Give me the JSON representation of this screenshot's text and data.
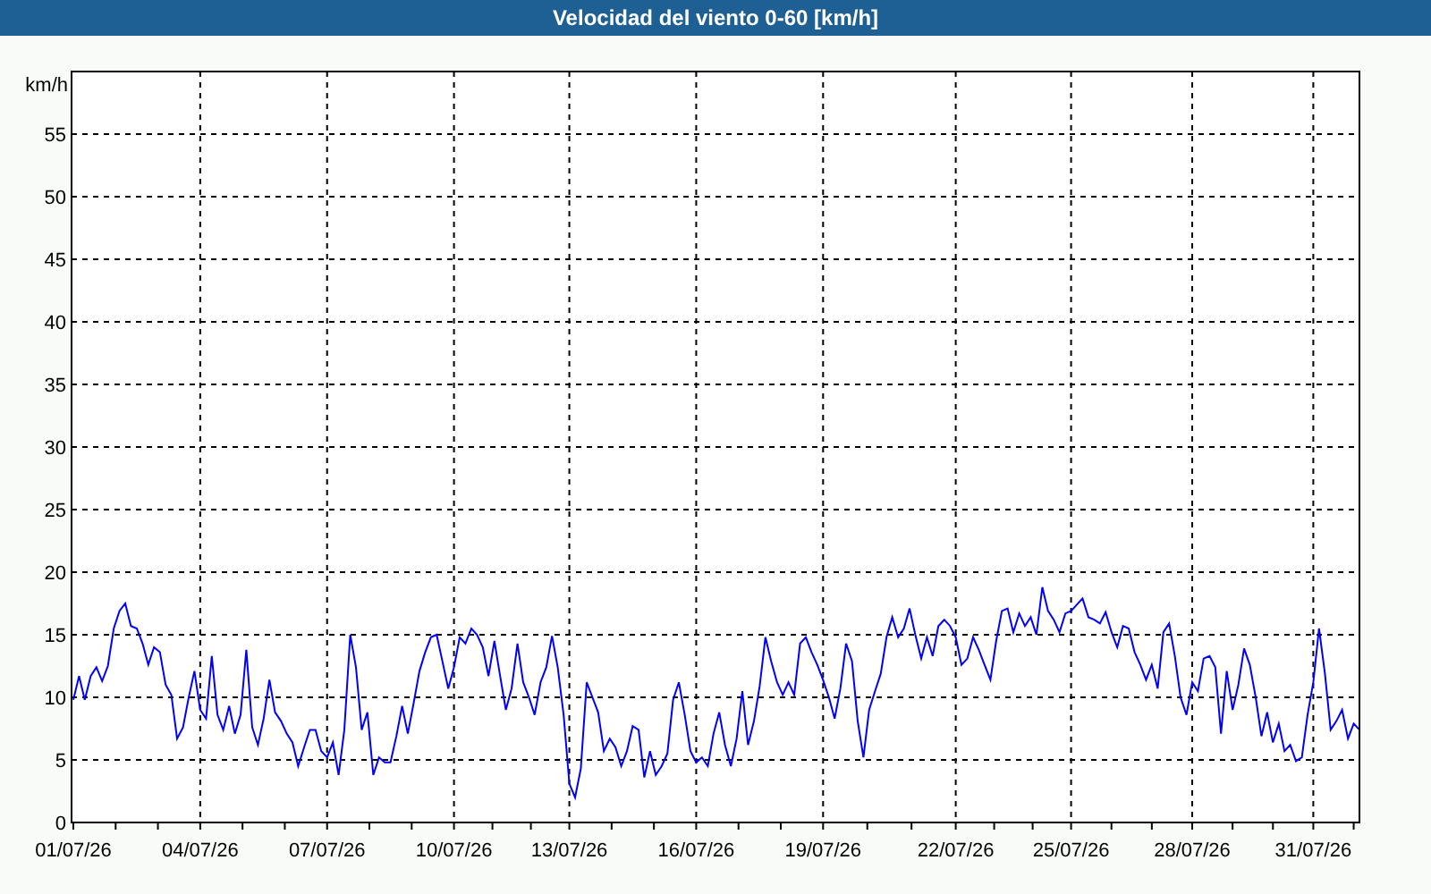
{
  "chart_data": {
    "type": "line",
    "grid": true,
    "title": "Velocidad del viento 0-60 [km/h]",
    "ylabel": "km/h",
    "ylim": [
      0,
      60
    ],
    "yticks": [
      0,
      5,
      10,
      15,
      20,
      25,
      30,
      35,
      40,
      45,
      50,
      55
    ],
    "categories": [
      "01/07/26",
      null,
      null,
      null,
      null,
      null,
      null,
      null,
      null,
      null,
      null,
      null,
      null,
      null,
      null,
      null,
      null,
      null,
      null,
      null,
      null,
      null,
      "04/07/26",
      null,
      null,
      null,
      null,
      null,
      null,
      null,
      null,
      null,
      null,
      null,
      null,
      null,
      null,
      null,
      null,
      null,
      null,
      null,
      null,
      null,
      "07/07/26",
      null,
      null,
      null,
      null,
      null,
      null,
      null,
      null,
      null,
      null,
      null,
      null,
      null,
      null,
      null,
      null,
      null,
      null,
      null,
      null,
      null,
      "10/07/26",
      null,
      null,
      null,
      null,
      null,
      null,
      null,
      null,
      null,
      null,
      null,
      null,
      null,
      null,
      null,
      null,
      null,
      null,
      null,
      "13/07/26",
      null,
      null,
      null,
      null,
      null,
      null,
      null,
      null,
      null,
      null,
      null,
      null,
      null,
      null,
      null,
      null,
      null,
      null,
      null,
      null,
      null,
      "16/07/26",
      null,
      null,
      null,
      null,
      null,
      null,
      null,
      null,
      null,
      null,
      null,
      null,
      null,
      null,
      null,
      null,
      null,
      null,
      null,
      null,
      null,
      "19/07/26",
      null,
      null,
      null,
      null,
      null,
      null,
      null,
      null,
      null,
      null,
      null,
      null,
      null,
      null,
      null,
      null,
      null,
      null,
      null,
      null,
      null,
      null,
      "22/07/26",
      null,
      null,
      null,
      null,
      null,
      null,
      null,
      null,
      null,
      null,
      null,
      null,
      null,
      null,
      null,
      null,
      null,
      null,
      null,
      "25/07/26",
      null,
      null,
      null,
      null,
      null,
      null,
      null,
      null,
      null,
      null,
      null,
      null,
      null,
      null,
      null,
      null,
      null,
      null,
      null,
      null,
      "28/07/26",
      null,
      null,
      null,
      null,
      null,
      null,
      null,
      null,
      null,
      null,
      null,
      null,
      null,
      null,
      null,
      null,
      null,
      null,
      null,
      null,
      "31/07/26",
      null,
      null,
      null,
      null,
      null,
      null,
      null,
      null
    ],
    "series": [
      {
        "color": "#0000ff",
        "values": [
          9.8,
          11.7,
          9.8,
          11.7,
          12.4,
          11.3,
          12.5,
          15.5,
          16.9,
          17.5,
          15.7,
          15.5,
          14.3,
          12.6,
          14.0,
          13.6,
          11.0,
          10.2,
          6.7,
          7.6,
          10.0,
          12.1,
          9.0,
          8.3,
          13.3,
          8.6,
          7.4,
          9.3,
          7.1,
          8.6,
          13.8,
          7.6,
          6.2,
          8.3,
          11.4,
          8.8,
          8.1,
          7.1,
          6.4,
          4.5,
          6.0,
          7.4,
          7.4,
          5.7,
          5.2,
          6.4,
          3.8,
          7.4,
          15.0,
          12.4,
          7.4,
          8.8,
          3.8,
          5.2,
          4.8,
          4.8,
          6.9,
          9.3,
          7.1,
          9.5,
          12.1,
          13.6,
          14.8,
          15.0,
          12.9,
          10.7,
          12.4,
          14.8,
          14.3,
          15.5,
          15.0,
          14.0,
          11.7,
          14.5,
          11.7,
          9.0,
          10.7,
          14.3,
          11.2,
          10.0,
          8.6,
          11.2,
          12.4,
          14.9,
          12.4,
          8.6,
          3.1,
          2.0,
          4.3,
          11.2,
          10.0,
          8.8,
          5.7,
          6.7,
          6.0,
          4.5,
          5.7,
          7.7,
          7.4,
          3.6,
          5.7,
          3.8,
          4.5,
          5.5,
          9.8,
          11.2,
          8.6,
          5.7,
          4.8,
          5.2,
          4.5,
          7.1,
          8.8,
          6.2,
          4.5,
          6.7,
          10.5,
          6.2,
          8.1,
          10.9,
          14.8,
          12.9,
          11.2,
          10.2,
          11.2,
          10.2,
          14.3,
          14.8,
          13.6,
          12.6,
          11.4,
          10.0,
          8.3,
          10.7,
          14.3,
          12.9,
          8.1,
          5.2,
          9.0,
          10.5,
          11.9,
          14.8,
          16.4,
          14.8,
          15.5,
          17.1,
          15.0,
          13.1,
          14.8,
          13.3,
          15.7,
          16.2,
          15.7,
          14.8,
          12.6,
          13.1,
          14.8,
          13.8,
          12.6,
          11.4,
          14.5,
          16.9,
          17.1,
          15.2,
          16.7,
          15.7,
          16.4,
          15.0,
          18.8,
          16.9,
          16.2,
          15.2,
          16.7,
          16.9,
          17.4,
          17.9,
          16.4,
          16.2,
          15.9,
          16.8,
          15.2,
          14.0,
          15.7,
          15.5,
          13.6,
          12.6,
          11.4,
          12.6,
          10.7,
          15.2,
          15.9,
          13.3,
          10.0,
          8.6,
          11.2,
          10.5,
          13.1,
          13.3,
          12.4,
          7.1,
          12.1,
          9.0,
          11.0,
          13.9,
          12.6,
          10.0,
          6.9,
          8.8,
          6.4,
          7.9,
          5.7,
          6.2,
          4.9,
          5.2,
          8.6,
          11.2,
          15.5,
          11.9,
          7.4,
          8.1,
          9.0,
          6.7,
          7.9,
          7.4
        ]
      }
    ]
  }
}
